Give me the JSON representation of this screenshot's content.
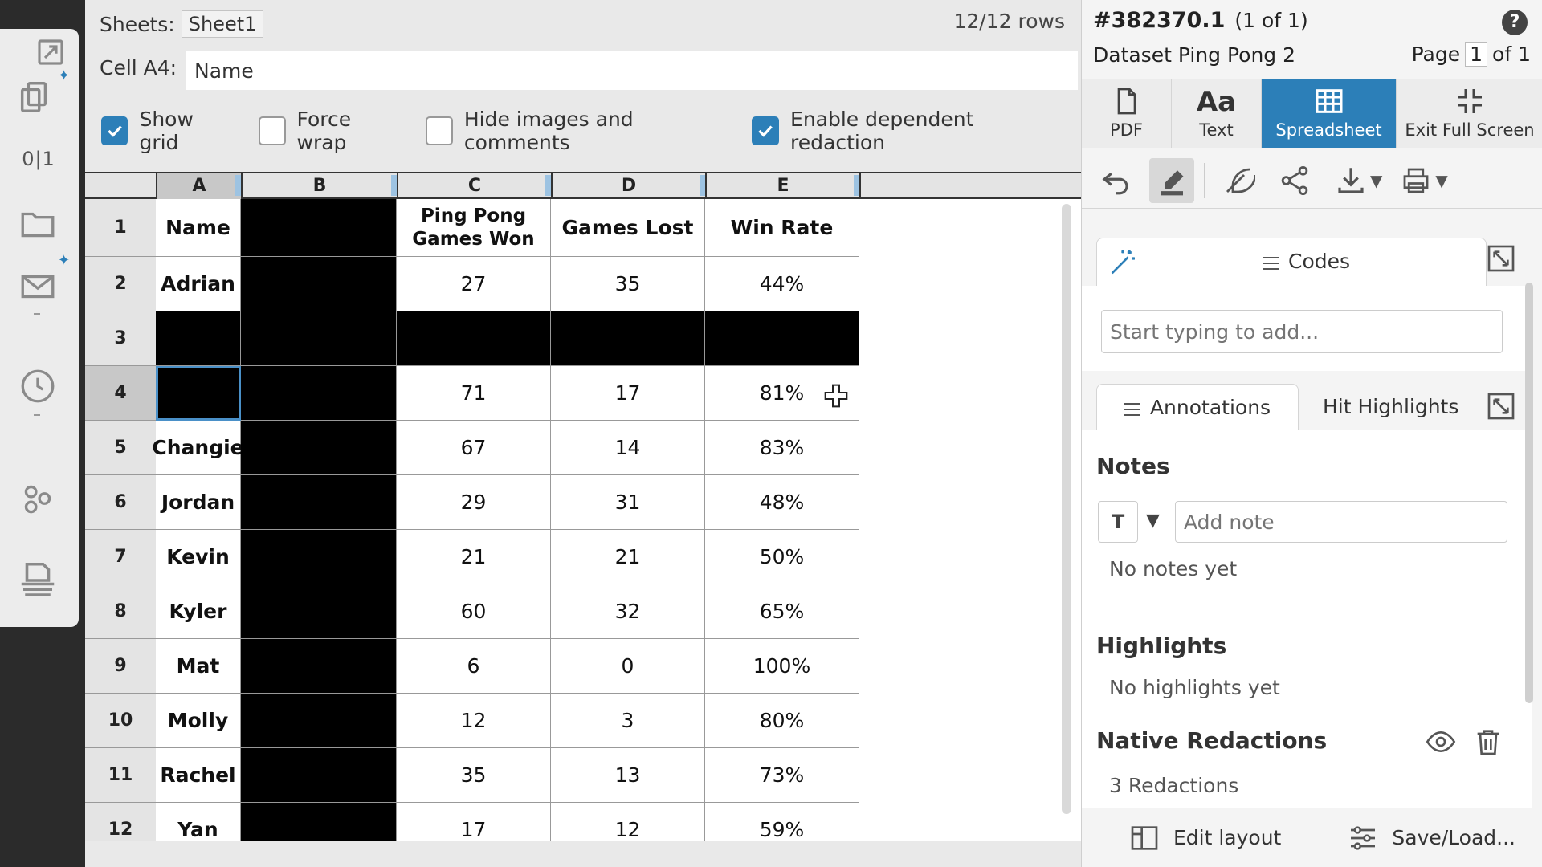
{
  "left_rail": {
    "icons": [
      "expand-icon",
      "copy-pages-icon",
      "folder-icon",
      "mail-icon",
      "clock-icon",
      "cluster-icon",
      "redaction-print-icon"
    ],
    "pages_count": "0|1"
  },
  "sheet_bar": {
    "sheets_label": "Sheets:",
    "sheet_name": "Sheet1",
    "rows_count": "12/12 rows"
  },
  "cell_bar": {
    "label": "Cell A4:",
    "value": "Name"
  },
  "options": [
    {
      "label": "Show grid",
      "checked": true
    },
    {
      "label": "Force wrap",
      "checked": false
    },
    {
      "label": "Hide images and comments",
      "checked": false
    },
    {
      "label": "Enable dependent redaction",
      "checked": true
    }
  ],
  "grid": {
    "columns": [
      "A",
      "B",
      "C",
      "D",
      "E"
    ],
    "selected_column": "A",
    "selected_row": "4",
    "rows": [
      {
        "n": "1",
        "cells": [
          "Name",
          "",
          "Ping Pong Games Won",
          "Games Lost",
          "Win Rate"
        ],
        "redacted": [
          false,
          true,
          false,
          false,
          false
        ],
        "header": true
      },
      {
        "n": "2",
        "cells": [
          "Adrian",
          "",
          "27",
          "35",
          "44%"
        ],
        "redacted": [
          false,
          true,
          false,
          false,
          false
        ]
      },
      {
        "n": "3",
        "cells": [
          "",
          "",
          "",
          "",
          ""
        ],
        "redacted": [
          true,
          true,
          true,
          true,
          true
        ]
      },
      {
        "n": "4",
        "cells": [
          "",
          "",
          "71",
          "17",
          "81%"
        ],
        "redacted": [
          true,
          true,
          false,
          false,
          false
        ],
        "selected_cell": 0
      },
      {
        "n": "5",
        "cells": [
          "Changie",
          "",
          "67",
          "14",
          "83%"
        ],
        "redacted": [
          false,
          true,
          false,
          false,
          false
        ]
      },
      {
        "n": "6",
        "cells": [
          "Jordan",
          "",
          "29",
          "31",
          "48%"
        ],
        "redacted": [
          false,
          true,
          false,
          false,
          false
        ]
      },
      {
        "n": "7",
        "cells": [
          "Kevin",
          "",
          "21",
          "21",
          "50%"
        ],
        "redacted": [
          false,
          true,
          false,
          false,
          false
        ]
      },
      {
        "n": "8",
        "cells": [
          "Kyler",
          "",
          "60",
          "32",
          "65%"
        ],
        "redacted": [
          false,
          true,
          false,
          false,
          false
        ]
      },
      {
        "n": "9",
        "cells": [
          "Mat",
          "",
          "6",
          "0",
          "100%"
        ],
        "redacted": [
          false,
          true,
          false,
          false,
          false
        ]
      },
      {
        "n": "10",
        "cells": [
          "Molly",
          "",
          "12",
          "3",
          "80%"
        ],
        "redacted": [
          false,
          true,
          false,
          false,
          false
        ]
      },
      {
        "n": "11",
        "cells": [
          "Rachel",
          "",
          "35",
          "13",
          "73%"
        ],
        "redacted": [
          false,
          true,
          false,
          false,
          false
        ]
      },
      {
        "n": "12",
        "cells": [
          "Yan",
          "",
          "17",
          "12",
          "59%"
        ],
        "redacted": [
          false,
          true,
          false,
          false,
          false
        ]
      }
    ]
  },
  "doc": {
    "id": "#382370.1",
    "position": "(1 of 1)",
    "dataset": "Dataset Ping Pong 2",
    "page_label": "Page",
    "page_current": "1",
    "page_of": "of 1",
    "help": "?"
  },
  "view_tabs": {
    "pdf": "PDF",
    "text": "Text",
    "text_glyph": "Aa",
    "spreadsheet": "Spreadsheet",
    "exit": "Exit Full Screen"
  },
  "codes": {
    "title": "Codes",
    "placeholder": "Start typing to add..."
  },
  "annotations": {
    "tab_annotations": "Annotations",
    "tab_hits": "Hit Highlights",
    "notes_title": "Notes",
    "note_type": "T",
    "note_placeholder": "Add note",
    "no_notes": "No notes yet",
    "highlights_title": "Highlights",
    "no_highlights": "No highlights yet",
    "redactions_title": "Native Redactions",
    "redactions_count": "3 Redactions"
  },
  "footer": {
    "edit_layout": "Edit layout",
    "save_load": "Save/Load..."
  },
  "colors": {
    "accent": "#2c7fb8",
    "redaction": "#000000"
  }
}
